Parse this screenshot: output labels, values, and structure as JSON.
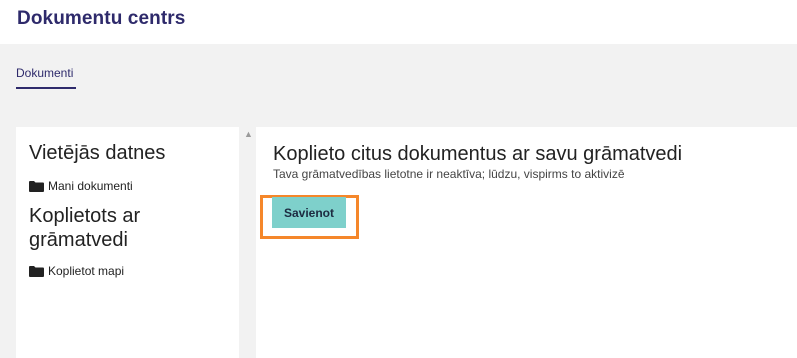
{
  "header": {
    "title": "Dokumentu centrs"
  },
  "tabs": [
    {
      "label": "Dokumenti",
      "active": true
    }
  ],
  "sidebar": {
    "local_section_title": "Vietējās datnes",
    "local_items": [
      {
        "label": "Mani dokumenti",
        "icon": "folder-icon"
      }
    ],
    "shared_section_title": "Koplietots ar grāmatvedi",
    "shared_items": [
      {
        "label": "Koplietot mapi",
        "icon": "folder-icon"
      }
    ]
  },
  "main": {
    "title": "Koplieto citus dokumentus ar savu grāmatvedi",
    "subtitle": "Tava grāmatvedības lietotne ir neaktīva; lūdzu, vispirms to aktivizē",
    "connect_button_label": "Savienot"
  },
  "colors": {
    "brand": "#2e2a6b",
    "button": "#7ed0cb",
    "highlight": "#f5872a",
    "background": "#f2f2f2"
  }
}
